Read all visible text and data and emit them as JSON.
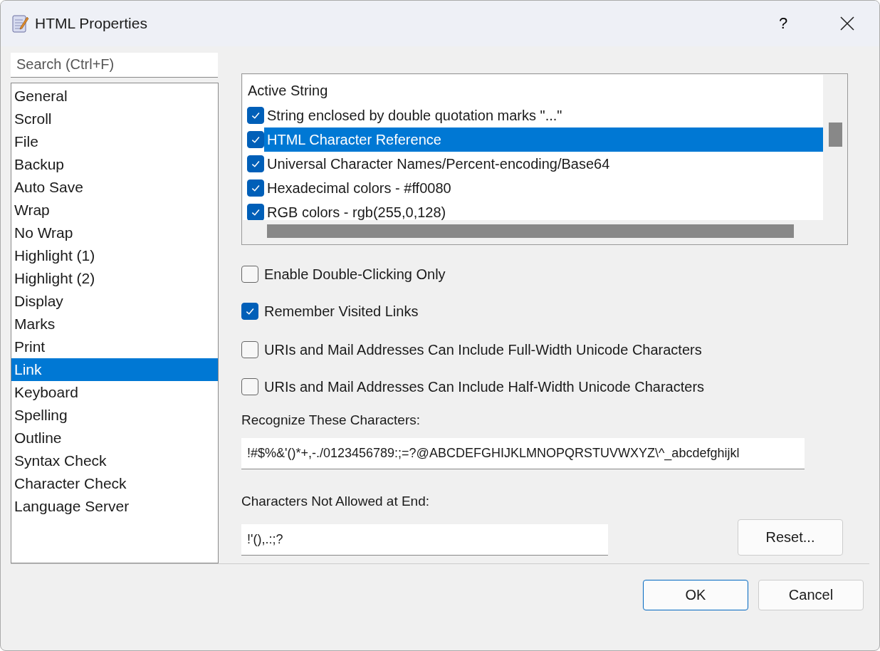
{
  "window": {
    "title": "HTML Properties",
    "help": "?"
  },
  "search": {
    "placeholder": "Search (Ctrl+F)"
  },
  "sidebar": {
    "items": [
      {
        "label": "General",
        "selected": false
      },
      {
        "label": "Scroll",
        "selected": false
      },
      {
        "label": "File",
        "selected": false
      },
      {
        "label": "Backup",
        "selected": false
      },
      {
        "label": "Auto Save",
        "selected": false
      },
      {
        "label": "Wrap",
        "selected": false
      },
      {
        "label": "No Wrap",
        "selected": false
      },
      {
        "label": "Highlight (1)",
        "selected": false
      },
      {
        "label": "Highlight (2)",
        "selected": false
      },
      {
        "label": "Display",
        "selected": false
      },
      {
        "label": "Marks",
        "selected": false
      },
      {
        "label": "Print",
        "selected": false
      },
      {
        "label": "Link",
        "selected": true
      },
      {
        "label": "Keyboard",
        "selected": false
      },
      {
        "label": "Spelling",
        "selected": false
      },
      {
        "label": "Outline",
        "selected": false
      },
      {
        "label": "Syntax Check",
        "selected": false
      },
      {
        "label": "Character Check",
        "selected": false
      },
      {
        "label": "Language Server",
        "selected": false
      }
    ]
  },
  "string_list": {
    "header": "Active String",
    "items": [
      {
        "label": "String enclosed by double quotation marks \"...\"",
        "checked": true,
        "selected": false
      },
      {
        "label": "HTML Character Reference",
        "checked": true,
        "selected": true
      },
      {
        "label": "Universal Character Names/Percent-encoding/Base64",
        "checked": true,
        "selected": false
      },
      {
        "label": "Hexadecimal colors - #ff0080",
        "checked": true,
        "selected": false
      },
      {
        "label": "RGB colors - rgb(255,0,128)",
        "checked": true,
        "selected": false
      }
    ]
  },
  "options": [
    {
      "label": "Enable Double-Clicking Only",
      "checked": false
    },
    {
      "label": "Remember Visited Links",
      "checked": true
    },
    {
      "label": "URIs and Mail Addresses Can Include Full-Width Unicode Characters",
      "checked": false
    },
    {
      "label": "URIs and Mail Addresses Can Include Half-Width Unicode Characters",
      "checked": false
    }
  ],
  "recognize": {
    "label": "Recognize These Characters:",
    "value": "!#$%&'()*+,-./0123456789:;=?@ABCDEFGHIJKLMNOPQRSTUVWXYZ\\^_abcdefghijkl"
  },
  "not_allowed": {
    "label": "Characters Not Allowed at End:",
    "value": "!'(),.:;?"
  },
  "reset_button": "Reset...",
  "buttons": [
    "OK",
    "Cancel"
  ]
}
